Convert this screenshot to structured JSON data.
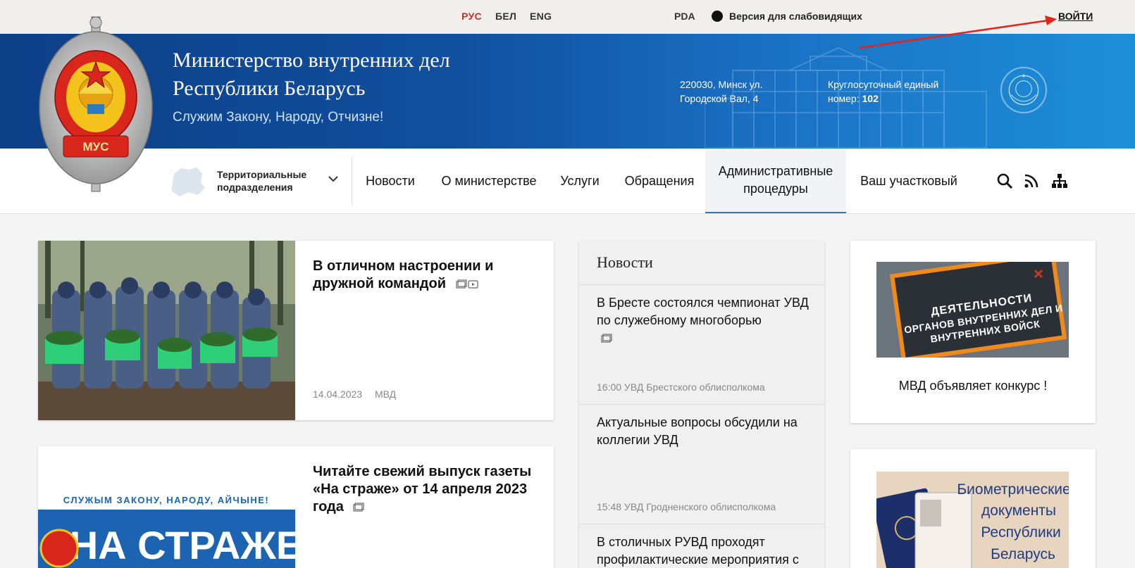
{
  "topbar": {
    "languages": [
      "РУС",
      "БЕЛ",
      "ENG"
    ],
    "pda": "PDA",
    "vision": "Версия для слабовидящих",
    "login": "ВОЙТИ"
  },
  "header": {
    "title_line1": "Министерство внутренних дел",
    "title_line2": "Республики Беларусь",
    "slogan": "Служим Закону, Народу, Отчизне!",
    "address_line1": "220030, Минск ул.",
    "address_line2": "Городской Вал, 4",
    "hotline_line1": "Круглосуточный единый",
    "hotline_label": "номер:",
    "hotline_number": "102",
    "logo_text": "МУС"
  },
  "nav": {
    "territorial_line1": "Территориальные",
    "territorial_line2": "подразделения",
    "items": [
      "Новости",
      "О министерстве",
      "Услуги",
      "Обращения",
      "Административные процедуры",
      "Ваш участковый"
    ],
    "admin_line1": "Административные",
    "admin_line2": "процедуры"
  },
  "main": {
    "news1": {
      "title": "В отличном настроении и дружной командой",
      "date": "14.04.2023",
      "source": "МВД"
    },
    "news2": {
      "title": "Читайте свежий выпуск газеты «На страже» от 14 апреля 2023 года",
      "paper_slogan": "СЛУЖЫМ ЗАКОНУ, НАРОДУ, АЙЧЫНЕ!",
      "paper_name": "НА СТРАЖЕ"
    }
  },
  "news_column": {
    "header": "Новости",
    "items": [
      {
        "title": "В Бресте состоялся чемпионат УВД по служебному многоборью",
        "meta": "16:00 УВД Брестского облисполкома"
      },
      {
        "title": "Актуальные вопросы обсудили на коллегии УВД",
        "meta": "15:48 УВД Гродненского облисполкома"
      },
      {
        "title": "В столичных РУВД проходят профилактические мероприятия с",
        "meta": ""
      }
    ]
  },
  "sidebar": {
    "banner1_lines": [
      "ДЕЯТЕЛЬНОСТИ",
      "ОРГАНОВ ВНУТРЕННИХ ДЕЛ И",
      "ВНУТРЕННИХ ВОЙСК"
    ],
    "banner1_caption": "МВД объявляет конкурс !",
    "banner2_lines": [
      "Биометрические",
      "документы",
      "Республики",
      "Беларусь"
    ]
  },
  "colors": {
    "accent_red": "#d12a1f",
    "banner_blue": "#114f9e",
    "active_underline": "#2b79c8"
  }
}
